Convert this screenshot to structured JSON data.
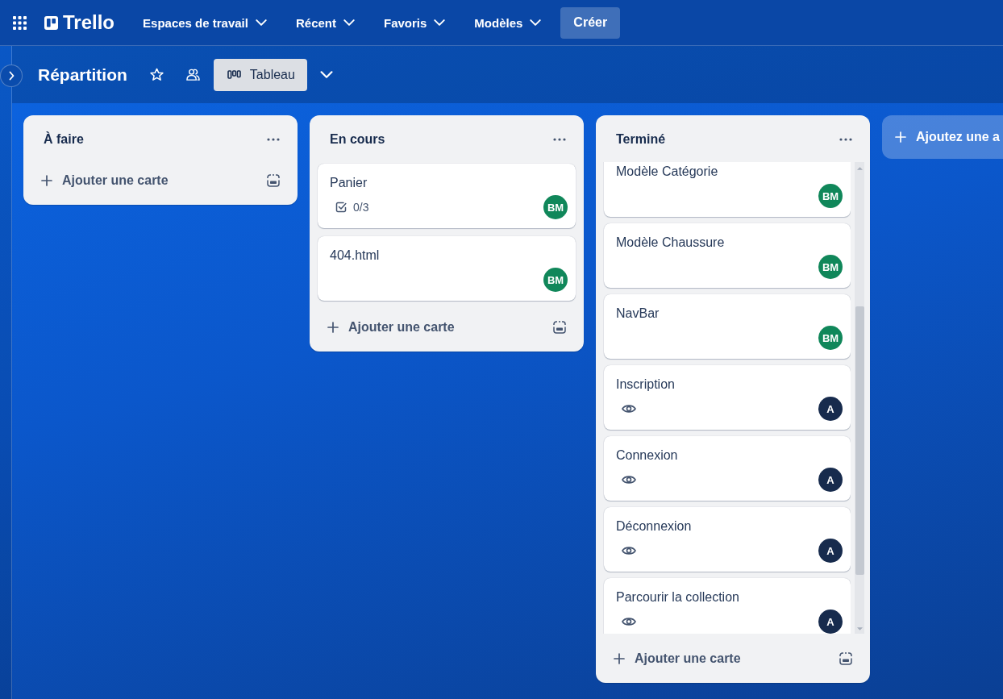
{
  "top_nav": {
    "logo": "Trello",
    "menus": [
      {
        "label": "Espaces de travail"
      },
      {
        "label": "Récent"
      },
      {
        "label": "Favoris"
      },
      {
        "label": "Modèles"
      }
    ],
    "create_button": "Créer"
  },
  "board_header": {
    "title": "Répartition",
    "view": "Tableau"
  },
  "lists": [
    {
      "title": "À faire",
      "scrollable": false,
      "add_card": "Ajouter une carte"
    },
    {
      "title": "En cours",
      "scrollable": false,
      "cards": [
        {
          "title": "Panier",
          "watching": false,
          "checklist": "0/3",
          "member": {
            "initials": "BM",
            "color": "#10875a"
          }
        },
        {
          "title": "404.html",
          "watching": false,
          "member": {
            "initials": "BM",
            "color": "#10875a"
          }
        }
      ],
      "add_card": "Ajouter une carte"
    },
    {
      "title": "Terminé",
      "scrollable": true,
      "cards": [
        {
          "title": "Modèle Catégorie",
          "watching": false,
          "member": {
            "initials": "BM",
            "color": "#10875a"
          }
        },
        {
          "title": "Modèle Chaussure",
          "watching": false,
          "member": {
            "initials": "BM",
            "color": "#10875a"
          }
        },
        {
          "title": "NavBar",
          "watching": false,
          "member": {
            "initials": "BM",
            "color": "#10875a"
          }
        },
        {
          "title": "Inscription",
          "watching": true,
          "member": {
            "initials": "A",
            "color": "#172b4d"
          }
        },
        {
          "title": "Connexion",
          "watching": true,
          "member": {
            "initials": "A",
            "color": "#172b4d"
          }
        },
        {
          "title": "Déconnexion",
          "watching": true,
          "member": {
            "initials": "A",
            "color": "#172b4d"
          }
        },
        {
          "title": "Parcourir la collection",
          "watching": true,
          "member": {
            "initials": "A",
            "color": "#172b4d"
          }
        }
      ],
      "add_card": "Ajouter une carte"
    }
  ],
  "add_list": "Ajoutez une a"
}
